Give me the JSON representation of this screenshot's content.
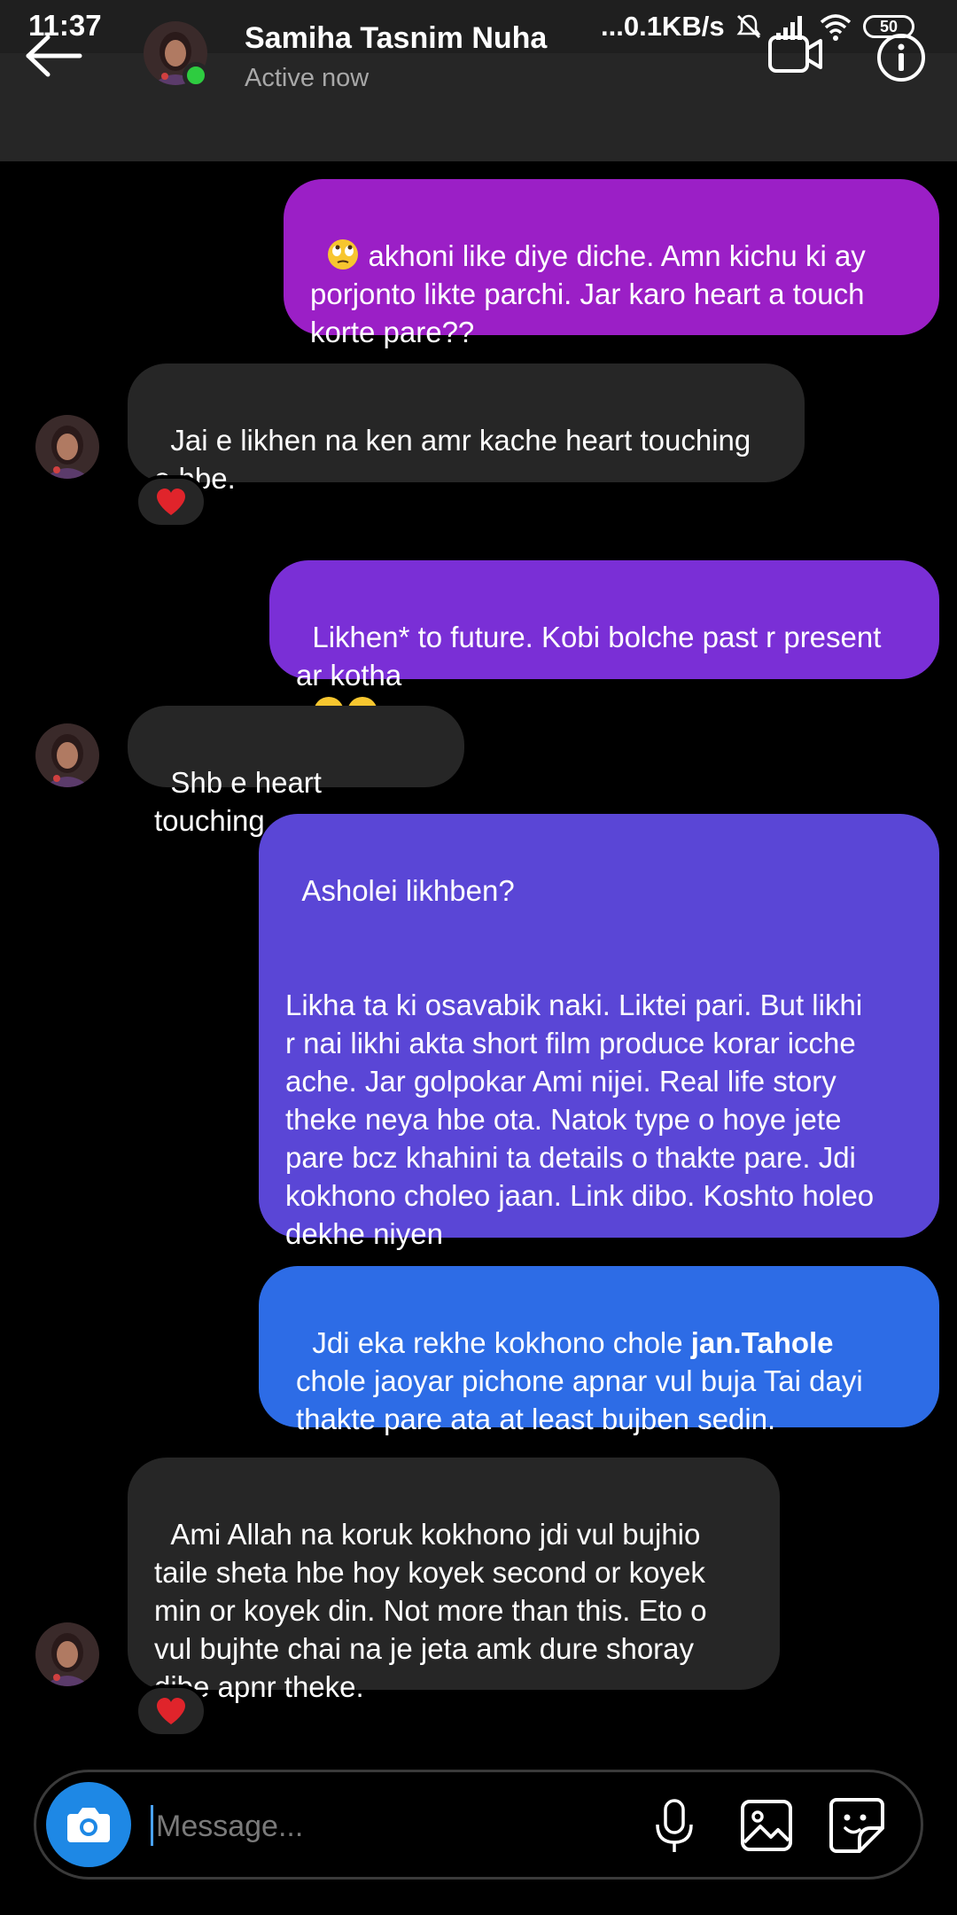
{
  "status_bar": {
    "time": "11:37",
    "net_speed": "...0.1KB/s",
    "battery": "50"
  },
  "header": {
    "contact_name": "Samiha Tasnim Nuha",
    "contact_status": "Active now"
  },
  "messages": [
    {
      "from": "me",
      "text": "akhoni like diye diche. Amn kichu ki ay\nporjonto likte parchi. Jar karo heart a touch\nkorte pare??",
      "leading_emoji": "eye-roll-emoji"
    },
    {
      "from": "them",
      "text": "Jai e likhen na ken amr kache heart touching\ne hbe.",
      "reaction": "❤️"
    },
    {
      "from": "me",
      "text": "Likhen* to future. Kobi bolche past r present\nar kotha",
      "trailing_emoji": "steam-face-emoji x2"
    },
    {
      "from": "them",
      "text": "Shb e heart touching"
    },
    {
      "from": "me",
      "text": "Asholei likhben?\n\n\nLikha ta ki osavabik naki. Liktei pari. But likhi\nr nai likhi akta short film produce korar icche\nache. Jar golpokar Ami nijei. Real life story\ntheke neya hbe ota. Natok type o hoye jete\npare bcz khahini ta details o thakte pare. Jdi\nkokhono choleo jaan. Link dibo. Koshto holeo\ndekhe niyen"
    },
    {
      "from": "me",
      "text_a": "Jdi eka rekhe kokhono chole ",
      "text_bold": "jan.Tahole",
      "text_b": "\nchole jaoyar pichone apnar vul buja Tai dayi\nthakte pare ata at least bujben sedin."
    },
    {
      "from": "them",
      "text": "Ami Allah na koruk kokhono jdi vul bujhio\ntaile sheta hbe hoy koyek second or koyek\nmin or koyek din. Not more than this. Eto o\nvul bujhte chai na je jeta amk dure shoray\ndibe apnr theke.",
      "reaction": "❤️"
    }
  ],
  "composer": {
    "placeholder": "Message..."
  },
  "colors": {
    "bubble_received": "#262626",
    "bubble_sent_1": "#9b1fc6",
    "bubble_sent_2": "#7a2fd6",
    "bubble_sent_3": "#5a46d6",
    "bubble_sent_4": "#2d6ce6",
    "accent_blue": "#1e88e5",
    "online_green": "#2ecc40"
  }
}
